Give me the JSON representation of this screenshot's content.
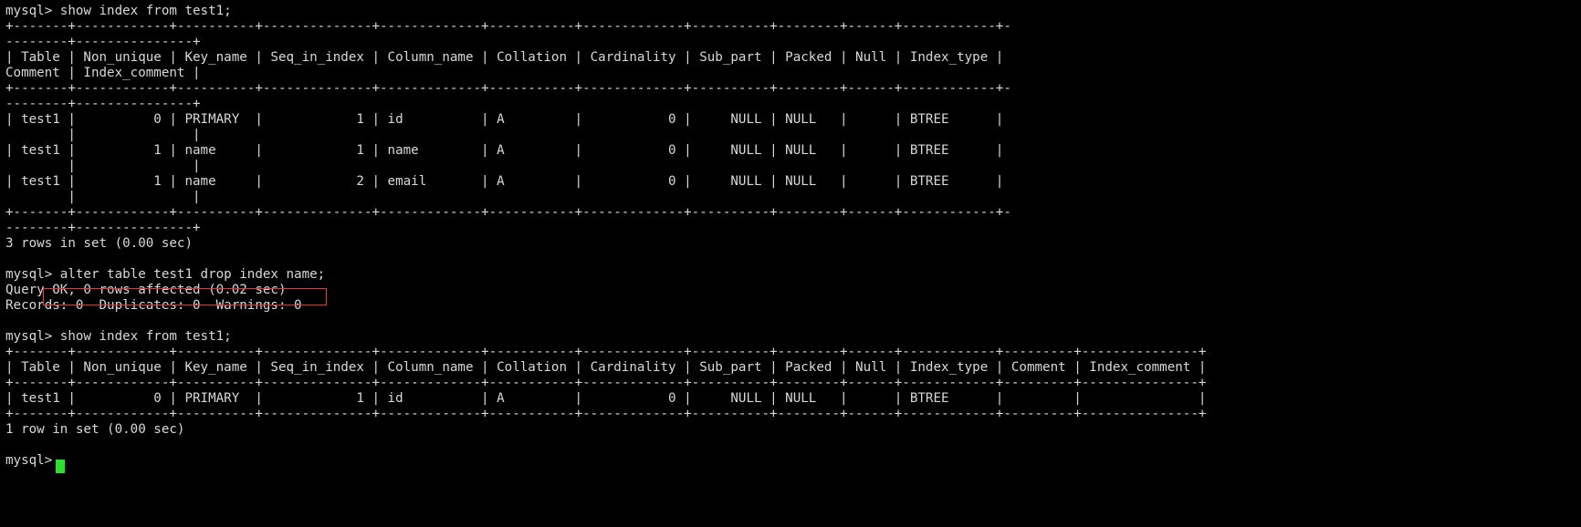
{
  "terminal": {
    "title": "mysql-client-terminal",
    "background_color": "#000000",
    "foreground_color": "#d8d8d8",
    "cursor_color": "#2ee02e",
    "highlight_color": "#e8343a",
    "prompt": "mysql>"
  },
  "lines": [
    {
      "id": "l0",
      "text": "mysql> show index from test1;",
      "kind": "command"
    },
    {
      "id": "l1",
      "text": "+-------+------------+----------+--------------+-------------+-----------+-------------+----------+--------+------+------------+-",
      "kind": "table-rule"
    },
    {
      "id": "l2",
      "text": "--------+---------------+",
      "kind": "table-rule-wrap"
    },
    {
      "id": "l3",
      "text": "| Table | Non_unique | Key_name | Seq_in_index | Column_name | Collation | Cardinality | Sub_part | Packed | Null | Index_type |",
      "kind": "table-header"
    },
    {
      "id": "l4",
      "text": "Comment | Index_comment |",
      "kind": "table-header-wrap"
    },
    {
      "id": "l5",
      "text": "+-------+------------+----------+--------------+-------------+-----------+-------------+----------+--------+------+------------+-",
      "kind": "table-rule"
    },
    {
      "id": "l6",
      "text": "--------+---------------+",
      "kind": "table-rule-wrap"
    },
    {
      "id": "l7",
      "text": "| test1 |          0 | PRIMARY  |            1 | id          | A         |           0 |     NULL | NULL   |      | BTREE      |",
      "kind": "table-row"
    },
    {
      "id": "l8",
      "text": "        |               |",
      "kind": "table-row-wrap"
    },
    {
      "id": "l9",
      "text": "| test1 |          1 | name     |            1 | name        | A         |           0 |     NULL | NULL   |      | BTREE      |",
      "kind": "table-row"
    },
    {
      "id": "l10",
      "text": "        |               |",
      "kind": "table-row-wrap"
    },
    {
      "id": "l11",
      "text": "| test1 |          1 | name     |            2 | email       | A         |           0 |     NULL | NULL   |      | BTREE      |",
      "kind": "table-row"
    },
    {
      "id": "l12",
      "text": "        |               |",
      "kind": "table-row-wrap"
    },
    {
      "id": "l13",
      "text": "+-------+------------+----------+--------------+-------------+-----------+-------------+----------+--------+------+------------+-",
      "kind": "table-rule"
    },
    {
      "id": "l14",
      "text": "--------+---------------+",
      "kind": "table-rule-wrap"
    },
    {
      "id": "l15",
      "text": "3 rows in set (0.00 sec)",
      "kind": "result-status"
    },
    {
      "id": "l16",
      "text": "",
      "kind": "blank"
    },
    {
      "id": "l17",
      "text": "mysql> alter table test1 drop index name;",
      "kind": "command-highlighted"
    },
    {
      "id": "l18",
      "text": "Query OK, 0 rows affected (0.02 sec)",
      "kind": "result-status"
    },
    {
      "id": "l19",
      "text": "Records: 0  Duplicates: 0  Warnings: 0",
      "kind": "result-status"
    },
    {
      "id": "l20",
      "text": "",
      "kind": "blank"
    },
    {
      "id": "l21",
      "text": "mysql> show index from test1;",
      "kind": "command"
    },
    {
      "id": "l22",
      "text": "+-------+------------+----------+--------------+-------------+-----------+-------------+----------+--------+------+------------+---------+---------------+",
      "kind": "table-rule"
    },
    {
      "id": "l23",
      "text": "| Table | Non_unique | Key_name | Seq_in_index | Column_name | Collation | Cardinality | Sub_part | Packed | Null | Index_type | Comment | Index_comment |",
      "kind": "table-header"
    },
    {
      "id": "l24",
      "text": "+-------+------------+----------+--------------+-------------+-----------+-------------+----------+--------+------+------------+---------+---------------+",
      "kind": "table-rule"
    },
    {
      "id": "l25",
      "text": "| test1 |          0 | PRIMARY  |            1 | id          | A         |           0 |     NULL | NULL   |      | BTREE      |         |               |",
      "kind": "table-row"
    },
    {
      "id": "l26",
      "text": "+-------+------------+----------+--------------+-------------+-----------+-------------+----------+--------+------+------------+---------+---------------+",
      "kind": "table-rule"
    },
    {
      "id": "l27",
      "text": "1 row in set (0.00 sec)",
      "kind": "result-status"
    },
    {
      "id": "l28",
      "text": "",
      "kind": "blank"
    },
    {
      "id": "l29",
      "text": "mysql> ",
      "kind": "prompt"
    }
  ],
  "commands": {
    "first_show_index": "show index from test1;",
    "alter_drop_index": "alter table test1 drop index name;",
    "second_show_index": "show index from test1;"
  },
  "results": {
    "first_row_count": "3 rows in set (0.00 sec)",
    "alter_query_ok": "Query OK, 0 rows affected (0.02 sec)",
    "alter_records": "Records: 0  Duplicates: 0  Warnings: 0",
    "second_row_count": "1 row in set (0.00 sec)"
  },
  "index_table": {
    "columns": [
      "Table",
      "Non_unique",
      "Key_name",
      "Seq_in_index",
      "Column_name",
      "Collation",
      "Cardinality",
      "Sub_part",
      "Packed",
      "Null",
      "Index_type",
      "Comment",
      "Index_comment"
    ],
    "before_drop": [
      [
        "test1",
        "0",
        "PRIMARY",
        "1",
        "id",
        "A",
        "0",
        "NULL",
        "NULL",
        "",
        "BTREE",
        "",
        ""
      ],
      [
        "test1",
        "1",
        "name",
        "1",
        "name",
        "A",
        "0",
        "NULL",
        "NULL",
        "",
        "BTREE",
        "",
        ""
      ],
      [
        "test1",
        "1",
        "name",
        "2",
        "email",
        "A",
        "0",
        "NULL",
        "NULL",
        "",
        "BTREE",
        "",
        ""
      ]
    ],
    "after_drop": [
      [
        "test1",
        "0",
        "PRIMARY",
        "1",
        "id",
        "A",
        "0",
        "NULL",
        "NULL",
        "",
        "BTREE",
        "",
        ""
      ]
    ]
  }
}
